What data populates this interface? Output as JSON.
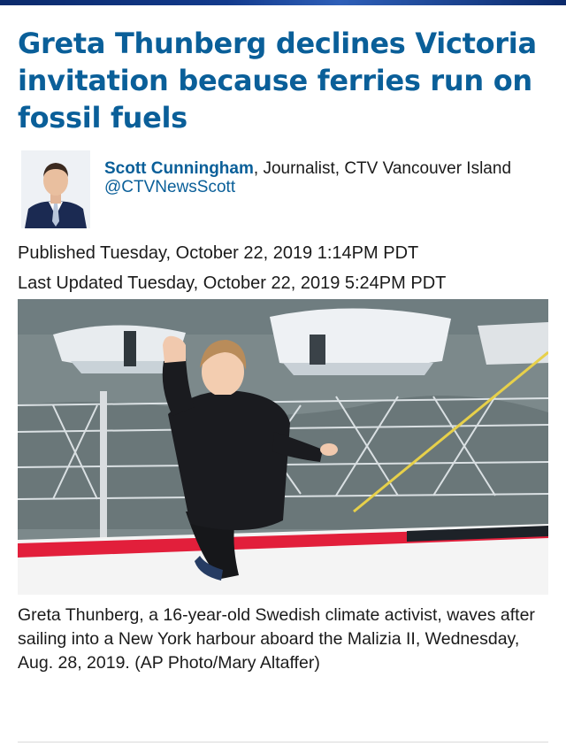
{
  "article": {
    "headline": "Greta Thunberg declines Victoria invitation because ferries run on fossil fuels",
    "author": {
      "name": "Scott Cunningham",
      "role": ", Journalist, CTV Vancouver Island",
      "twitter": "@CTVNewsScott"
    },
    "published": "Published Tuesday, October 22, 2019 1:14PM PDT",
    "updated": "Last Updated Tuesday, October 22, 2019 5:24PM PDT",
    "photo_caption": "Greta Thunberg, a 16-year-old Swedish climate activist, waves after sailing into a New York harbour aboard the Malizia II, Wednesday, Aug. 28, 2019. (AP Photo/Mary Altaffer)"
  },
  "colors": {
    "headline": "#0a5f99",
    "link": "#0a5f99",
    "top_bar": "#123a8c"
  },
  "icons": {
    "author_photo": "author-headshot",
    "main_photo": "greta-thunberg-on-sailboat-photo"
  }
}
